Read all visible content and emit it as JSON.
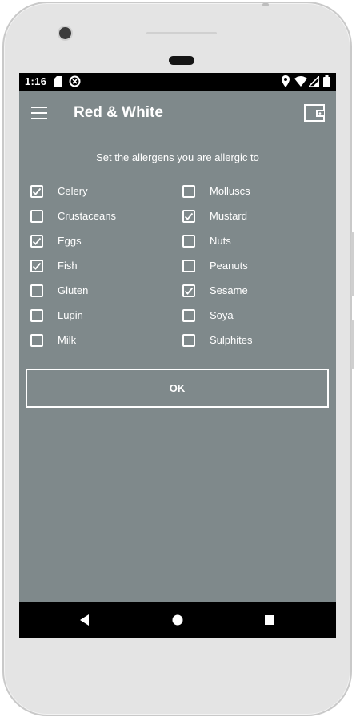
{
  "status_bar": {
    "time": "1:16",
    "icons": [
      "sd-card-icon",
      "sync-icon",
      "location-icon",
      "wifi-icon",
      "signal-icon",
      "battery-icon"
    ]
  },
  "app_bar": {
    "title": "Red & White",
    "menu_icon": "menu-icon",
    "action_icon": "wallet-icon"
  },
  "prompt": "Set the allergens you are allergic to",
  "allergens_left": [
    {
      "label": "Celery",
      "checked": true
    },
    {
      "label": "Crustaceans",
      "checked": false
    },
    {
      "label": "Eggs",
      "checked": true
    },
    {
      "label": "Fish",
      "checked": true
    },
    {
      "label": "Gluten",
      "checked": false
    },
    {
      "label": "Lupin",
      "checked": false
    },
    {
      "label": "Milk",
      "checked": false
    }
  ],
  "allergens_right": [
    {
      "label": "Molluscs",
      "checked": false
    },
    {
      "label": "Mustard",
      "checked": true
    },
    {
      "label": "Nuts",
      "checked": false
    },
    {
      "label": "Peanuts",
      "checked": false
    },
    {
      "label": "Sesame",
      "checked": true
    },
    {
      "label": "Soya",
      "checked": false
    },
    {
      "label": "Sulphites",
      "checked": false
    }
  ],
  "ok_button": {
    "label": "OK"
  },
  "nav_bar": {
    "icons": [
      "back-icon",
      "home-icon",
      "recents-icon"
    ]
  },
  "colors": {
    "screen_background": "#7f898b",
    "foreground": "#ffffff",
    "status_bar": "#000000",
    "phone_frame": "#e4e4e4"
  }
}
